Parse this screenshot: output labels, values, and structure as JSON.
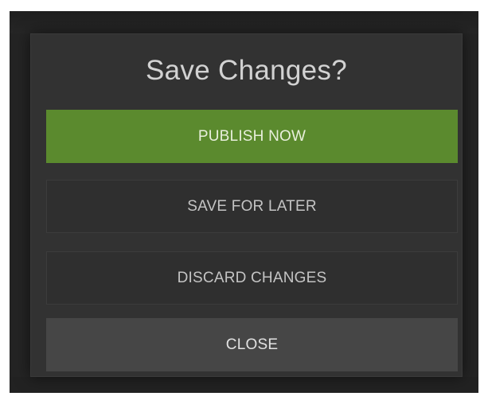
{
  "dialog": {
    "title": "Save Changes?",
    "buttons": {
      "publish": "PUBLISH NOW",
      "save_later": "SAVE FOR LATER",
      "discard": "DISCARD CHANGES",
      "close": "CLOSE"
    }
  },
  "colors": {
    "primary": "#5b8a2e",
    "dialog_background": "#323232",
    "close_background": "#464646"
  }
}
